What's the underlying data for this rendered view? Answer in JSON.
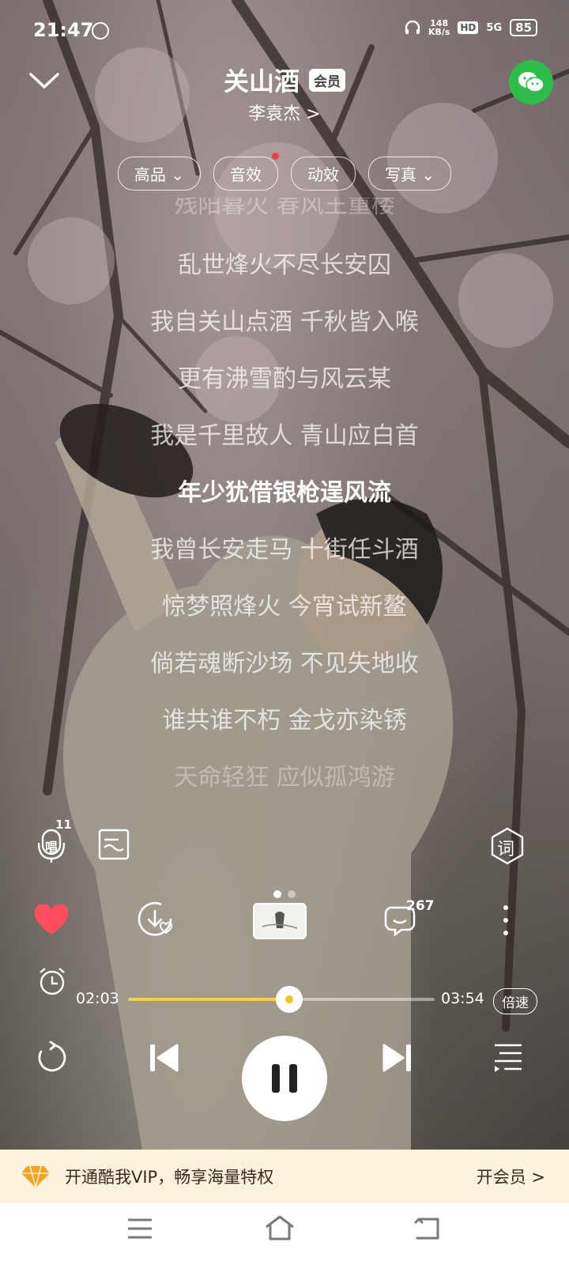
{
  "status_bar": {
    "time": "21:47",
    "net_speed_value": "148",
    "net_speed_unit": "KB/s",
    "hd": "HD",
    "signal": "5G",
    "battery": "85"
  },
  "header": {
    "song_title": "关山酒",
    "vip_badge": "会员",
    "artist": "李袁杰 >"
  },
  "chips": [
    {
      "label": "高品 ⌄"
    },
    {
      "label": "音效",
      "has_dot": true
    },
    {
      "label": "动效"
    },
    {
      "label": "写真 ⌄"
    }
  ],
  "lyrics": [
    "残阳暮火 春风王重楼",
    "乱世烽火不尽长安囚",
    "我自关山点酒  千秋皆入喉",
    "更有沸雪酌与风云某",
    "我是千里故人  青山应白首",
    "年少犹借银枪逞风流",
    "我曾长安走马  十街任斗酒",
    "惊梦照烽火  今宵试新鳌",
    "倘若魂断沙场  不见失地收",
    "谁共谁不朽  金戈亦染锈",
    "天命轻狂  应似孤鸿游"
  ],
  "active_lyric_index": 5,
  "tools": {
    "sing_count": "11",
    "sing_label": "唱",
    "lyrics_label": "词",
    "comment_count": "267"
  },
  "progress": {
    "current": "02:03",
    "total": "03:54",
    "fraction": 0.525,
    "speed_label": "倍速"
  },
  "vip_banner": {
    "text": "开通酷我VIP，畅享海量特权",
    "cta": "开会员 >"
  },
  "colors": {
    "accent": "#f6d23a",
    "heart": "#ff4f5e",
    "wechat": "#2ebd4a"
  }
}
